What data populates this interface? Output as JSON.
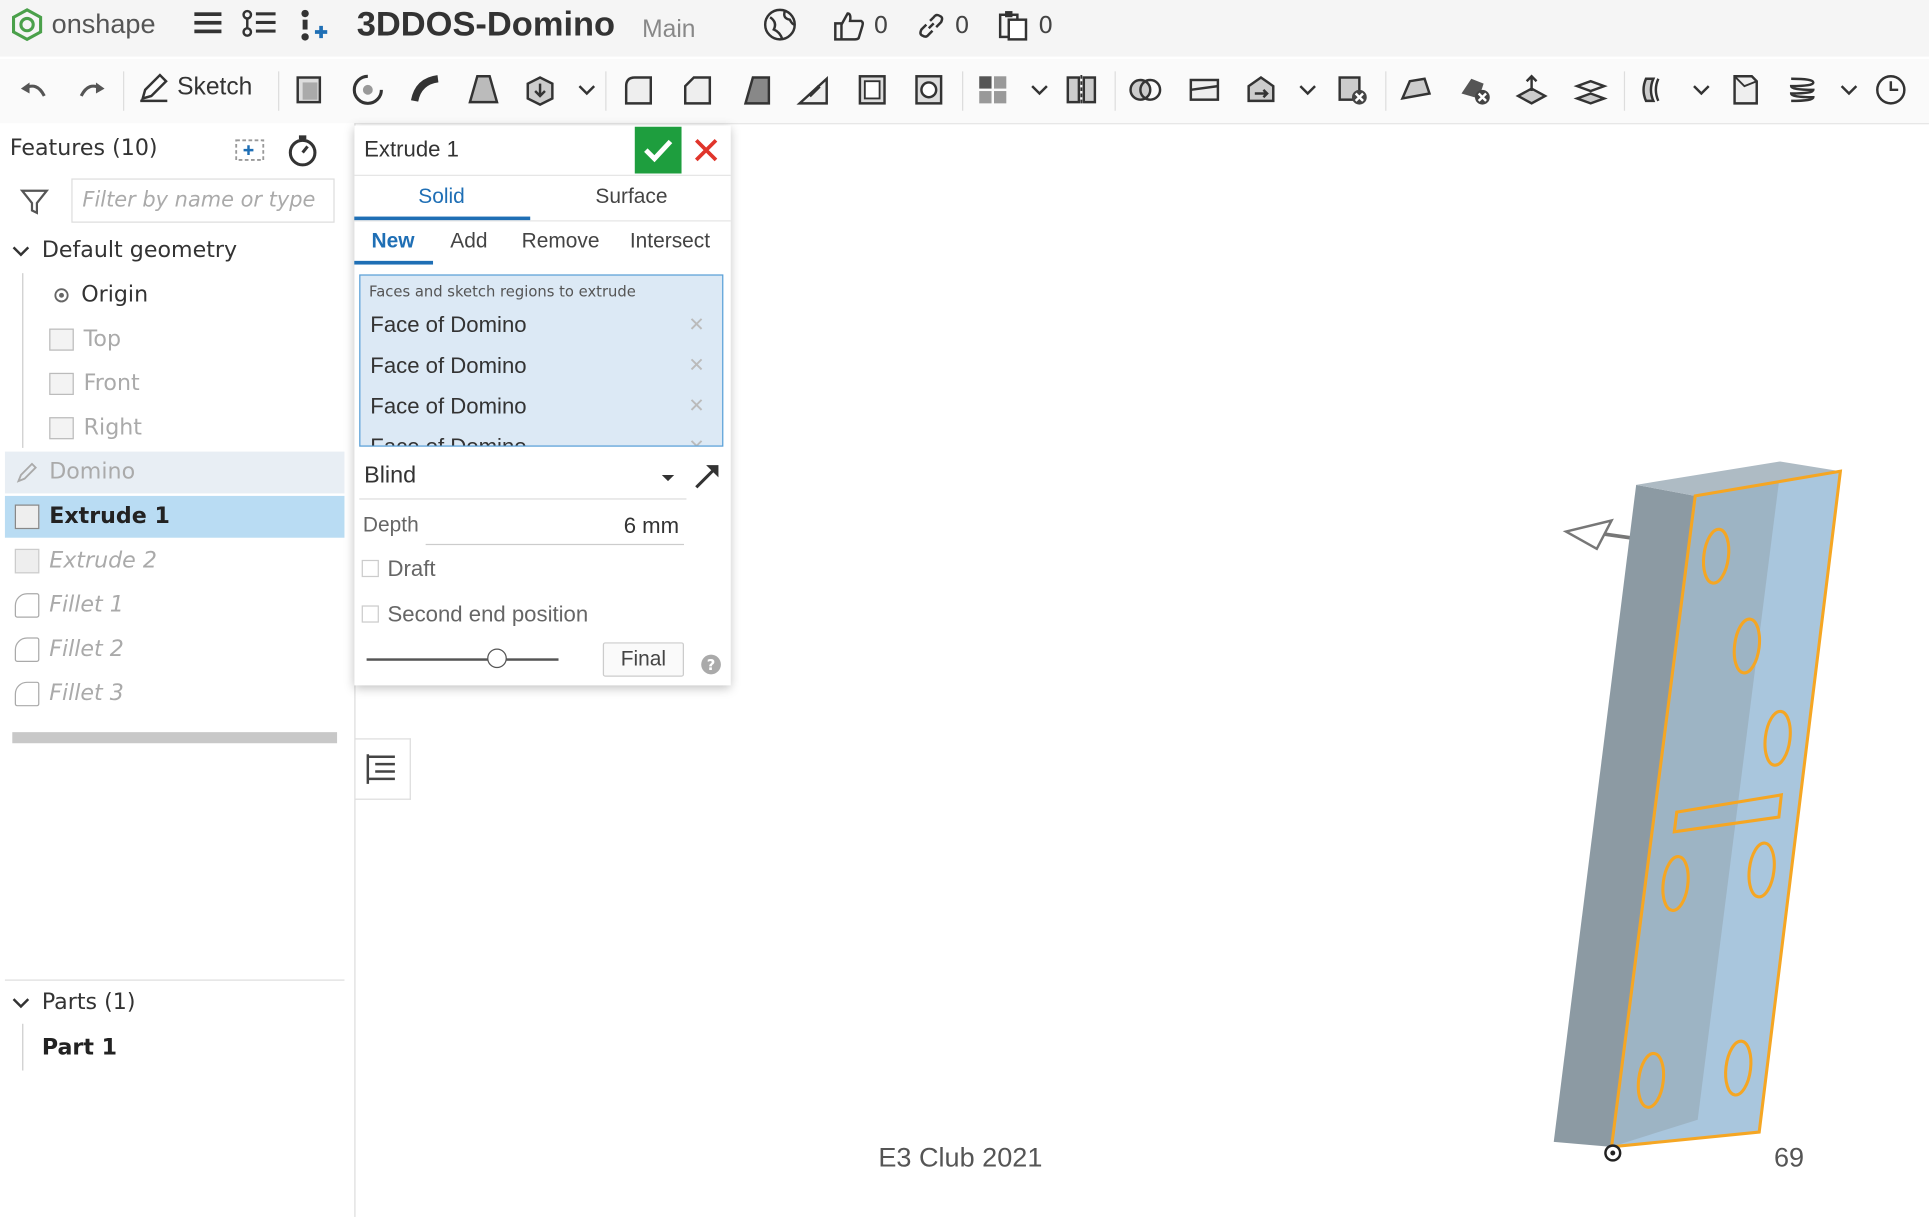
{
  "app": {
    "logo_text": "onshape"
  },
  "document": {
    "title": "3DDOS-Domino",
    "branch": "Main"
  },
  "counters": {
    "likes": "0",
    "links": "0",
    "copies": "0"
  },
  "toolbar": {
    "sketch_label": "Sketch"
  },
  "features_panel": {
    "title": "Features (10)",
    "filter_placeholder": "Filter by name or type",
    "default_geometry_label": "Default geometry",
    "items": [
      {
        "label": "Origin"
      },
      {
        "label": "Top"
      },
      {
        "label": "Front"
      },
      {
        "label": "Right"
      },
      {
        "label": "Domino"
      },
      {
        "label": "Extrude 1"
      },
      {
        "label": "Extrude 2"
      },
      {
        "label": "Fillet 1"
      },
      {
        "label": "Fillet 2"
      },
      {
        "label": "Fillet 3"
      }
    ],
    "parts_label": "Parts (1)",
    "parts": [
      {
        "label": "Part 1"
      }
    ]
  },
  "extrude_dialog": {
    "title": "Extrude 1",
    "type_tabs": [
      "Solid",
      "Surface"
    ],
    "op_tabs": [
      "New",
      "Add",
      "Remove",
      "Intersect"
    ],
    "selection_label": "Faces and sketch regions to extrude",
    "selections": [
      "Face of Domino",
      "Face of Domino",
      "Face of Domino",
      "Face of Domino"
    ],
    "end_type": "Blind",
    "depth_label": "Depth",
    "depth_value": "6 mm",
    "draft_label": "Draft",
    "second_end_label": "Second end position",
    "final_label": "Final"
  },
  "slide_footer": {
    "text": "E3 Club 2021",
    "page": "69"
  },
  "colors": {
    "accent_blue": "#1f6fb5",
    "confirm_green": "#1e9e3e",
    "cancel_red": "#e0352b",
    "edge_orange": "#f5a623",
    "body_blue": "#a9c6dd",
    "body_gray": "#8c9aa3"
  }
}
